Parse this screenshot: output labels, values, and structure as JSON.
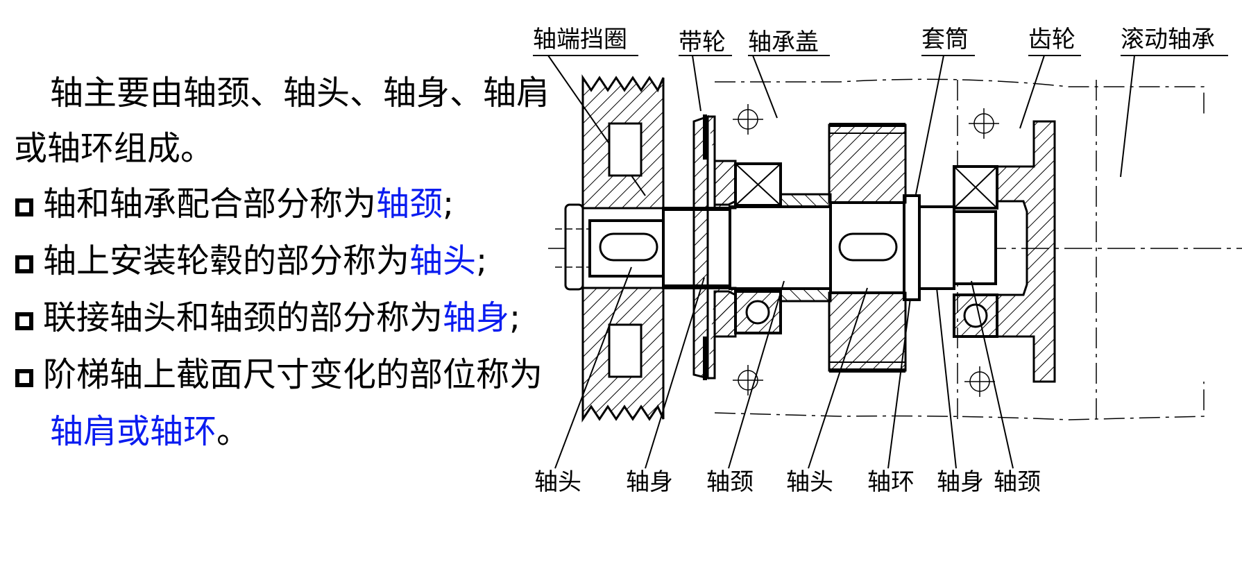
{
  "intro": {
    "line1": "轴主要由轴颈、轴头、轴身、轴肩",
    "line2": "或轴环组成。"
  },
  "bullets": [
    {
      "text": "轴和轴承配合部分称为",
      "highlight": "轴颈",
      "end": ";"
    },
    {
      "text": "轴上安装轮毂的部分称为",
      "highlight": "轴头",
      "end": ";"
    },
    {
      "text": "联接轴头和轴颈的部分称为",
      "highlight": "轴身",
      "end": ";"
    },
    {
      "text": "阶梯轴上截面尺寸变化的部位称为",
      "highlight": "轴肩或轴环",
      "end": "。"
    }
  ],
  "colors": {
    "highlight": "#0a1cf0",
    "text": "#000000"
  },
  "diagram": {
    "top_labels": [
      "轴端挡圈",
      "带轮",
      "轴承盖",
      "套筒",
      "齿轮",
      "滚动轴承"
    ],
    "bottom_labels": [
      "轴头",
      "轴身",
      "轴颈",
      "轴头",
      "轴环",
      "轴身",
      "轴颈"
    ]
  }
}
